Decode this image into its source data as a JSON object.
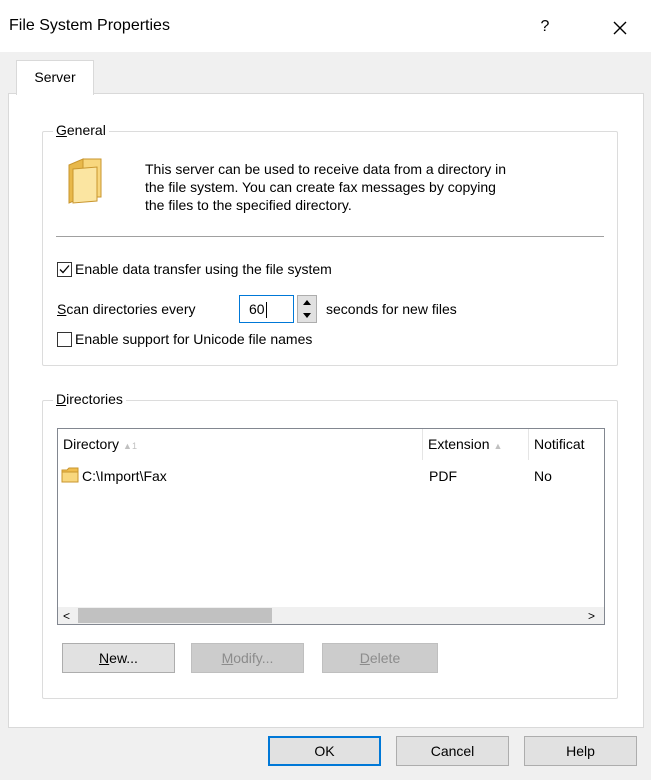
{
  "window": {
    "title": "File System Properties",
    "help_glyph": "?",
    "close_glyph": "✕"
  },
  "tabs": [
    {
      "label": "Server"
    }
  ],
  "general": {
    "caption_prefix": "",
    "caption_mnemonic": "G",
    "caption_rest": "eneral",
    "description_line1": "This server can be used to receive data from a directory in",
    "description_line2": "the file system. You can create fax messages by copying",
    "description_line3": "the files to the specified directory.",
    "enable_transfer_label": "Enable data transfer using the file system",
    "enable_transfer_checked": true,
    "scan_label_mnemonic": "S",
    "scan_label_rest": "can directories every",
    "scan_value": "60",
    "scan_suffix": "seconds for new files",
    "unicode_label": "Enable support for Unicode file names",
    "unicode_checked": false
  },
  "directories": {
    "caption_mnemonic": "D",
    "caption_rest": "irectories",
    "columns": [
      {
        "label": "Directory",
        "sort_arrow": "▲",
        "sort_index": "1"
      },
      {
        "label": "Extension",
        "sort_arrow": "▲",
        "sort_index": ""
      },
      {
        "label": "Notificat",
        "sort_arrow": "",
        "sort_index": ""
      }
    ],
    "rows": [
      {
        "directory": "C:\\Import\\Fax",
        "extension": "PDF",
        "notification": "No"
      }
    ],
    "scroll_left": "<",
    "scroll_right": ">"
  },
  "buttons": {
    "new_mnemonic": "N",
    "new_rest": "ew...",
    "modify_mnemonic": "M",
    "modify_rest": "odify...",
    "delete_mnemonic": "D",
    "delete_rest": "elete"
  },
  "footer": {
    "ok": "OK",
    "cancel": "Cancel",
    "help": "Help"
  },
  "colors": {
    "accent": "#0078d7",
    "folder": "#f5c85a",
    "dialog_bg": "#f0f0f0"
  }
}
